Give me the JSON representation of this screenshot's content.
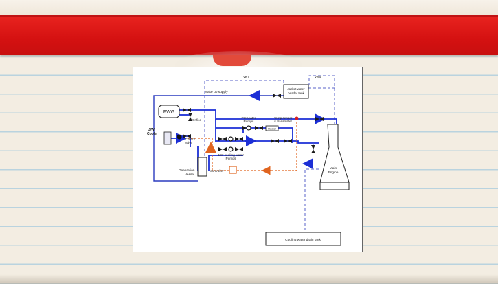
{
  "diagram": {
    "labels": {
      "vent_left": "Vent",
      "vent_right": "Vent",
      "make_up_supply": "Make up supply",
      "header_tank_line1": "Jacket water",
      "header_tank_line2": "header tank",
      "fwg": "FWG",
      "orifice": "Orifice",
      "jw_cooler_line1": "J/W",
      "jw_cooler_line2": "Cooler",
      "control_valve_line1": "Control",
      "control_valve_line2": "valve",
      "preheater_pumps_line1": "Preheater",
      "preheater_pumps_line2": "Pumps",
      "temp_sensor_line1": "Temp sensor",
      "temp_sensor_line2": "& transmitter",
      "heater": "Heater",
      "jw_pumps_line1": "J/W cooling water",
      "jw_pumps_line2": "Pumps",
      "deaeration_line1": "Deaeration",
      "deaeration_line2": "Vessel",
      "controller": "controller",
      "main_engine_line1": "Main",
      "main_engine_line2": "Engine",
      "drain_tank": "Cooling water drain tank"
    },
    "colors": {
      "circulation": "#1c2fd6",
      "supply": "#2b3bbf",
      "vent": "#5a63c8",
      "control_signal": "#e0641f",
      "valve": "#1a1a1a",
      "sensor_point": "#d81e1e"
    }
  }
}
